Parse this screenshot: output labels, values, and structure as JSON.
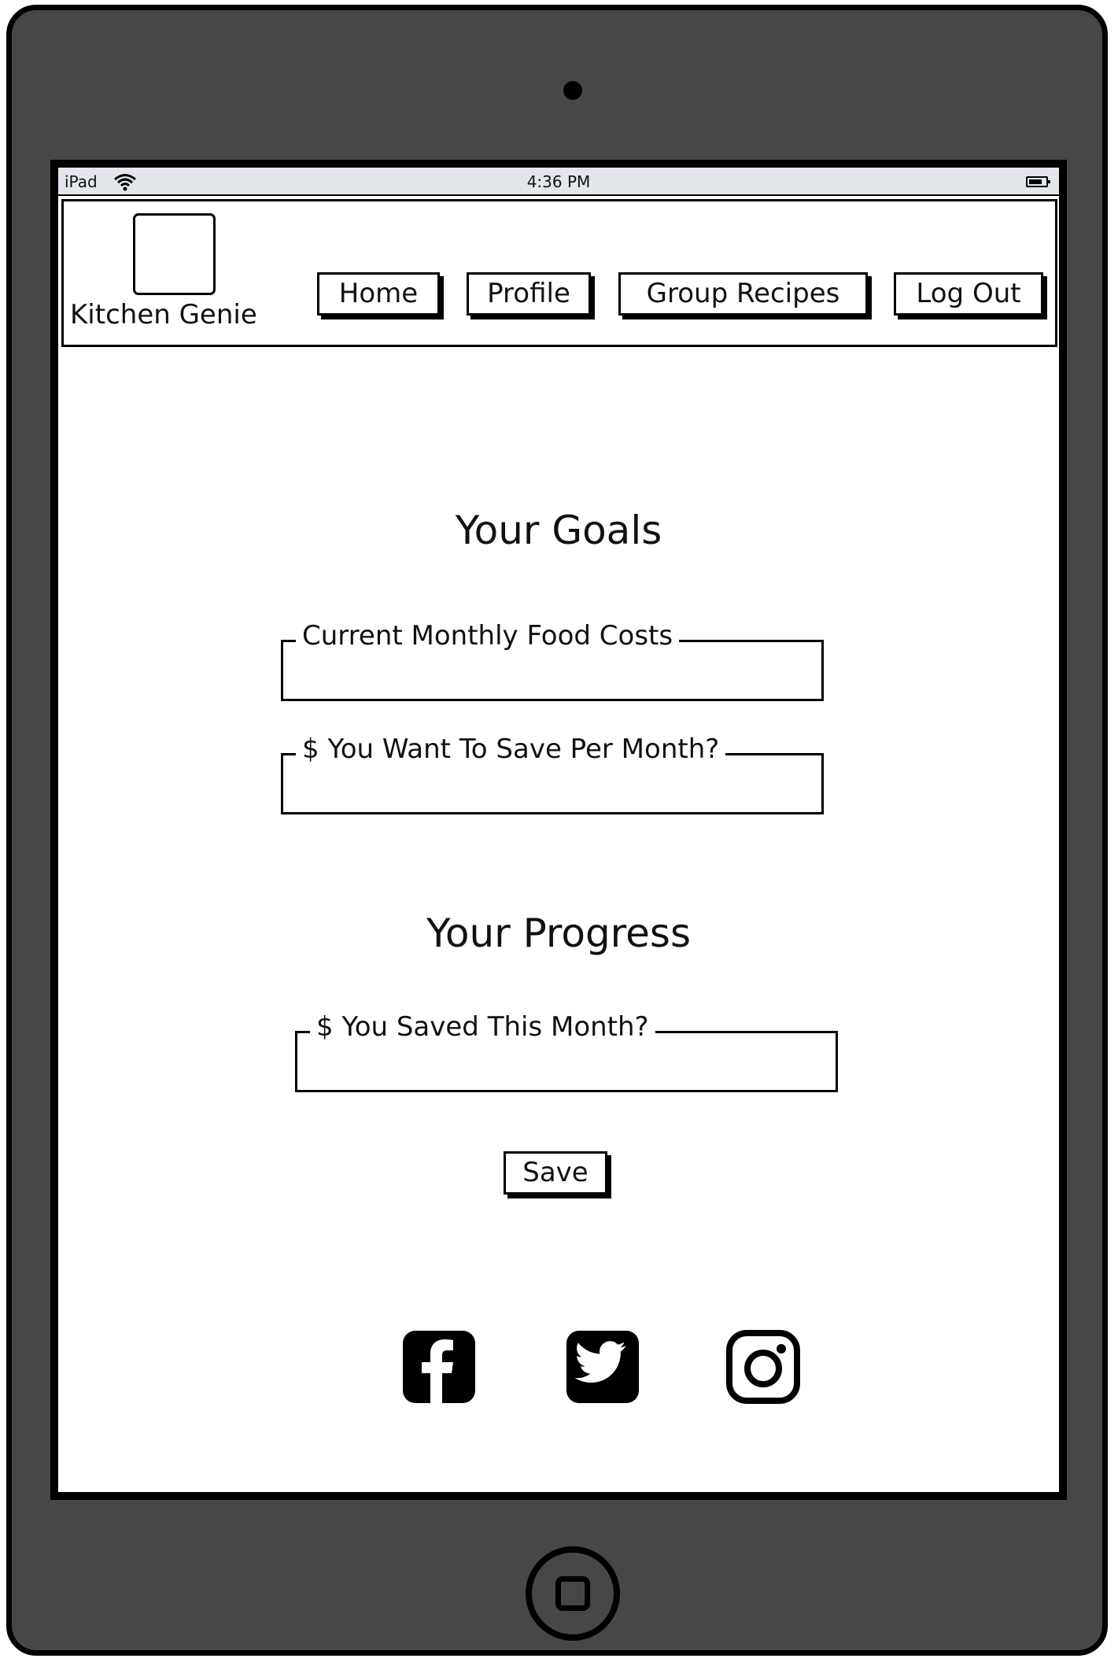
{
  "status_bar": {
    "device": "iPad",
    "time": "4:36 PM",
    "wifi_icon": "wifi-icon",
    "battery_icon": "battery-icon"
  },
  "header": {
    "logo_icon": "logo-placeholder",
    "brand": "Kitchen Genie",
    "nav": [
      {
        "label": "Home"
      },
      {
        "label": "Profile"
      },
      {
        "label": "Group Recipes"
      },
      {
        "label": "Log Out"
      }
    ]
  },
  "goals": {
    "title": "Your Goals",
    "fields": [
      {
        "label": "Current Monthly Food Costs",
        "value": ""
      },
      {
        "label": "$ You Want To Save Per Month?",
        "value": ""
      }
    ]
  },
  "progress": {
    "title": "Your Progress",
    "field": {
      "label": "$ You Saved This Month?",
      "value": ""
    },
    "save_label": "Save"
  },
  "social": [
    "facebook-icon",
    "twitter-icon",
    "instagram-icon"
  ],
  "colors": {
    "frame": "#474747",
    "status_bar": "#e3e6ea",
    "ink": "#000000",
    "screen": "#ffffff"
  }
}
